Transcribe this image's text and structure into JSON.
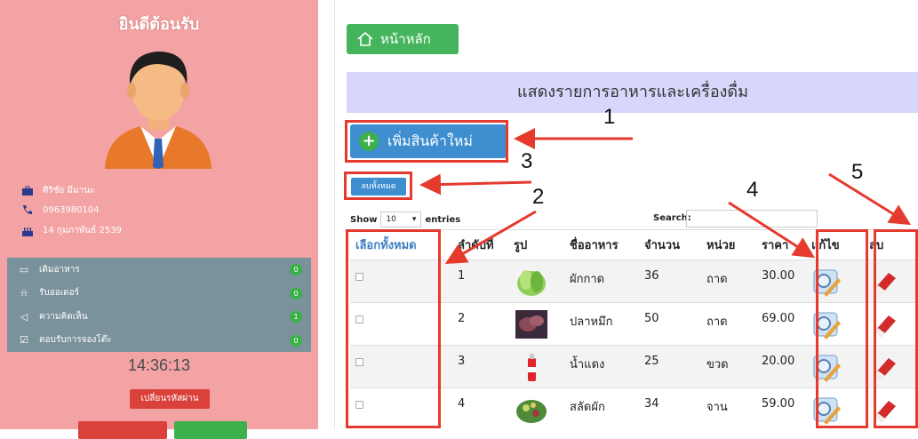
{
  "sidebar": {
    "welcome": "ยินดีต้อนรับ",
    "name": "ศิริชัย มีมานะ",
    "phone": "0963980104",
    "birthday": "14 กุมภาพันธ์ 2539",
    "menu": [
      {
        "label": "เติมอาหาร",
        "icon": "battery-icon",
        "count": "0"
      },
      {
        "label": "รับออเดอร์",
        "icon": "bell-icon",
        "count": "0"
      },
      {
        "label": "ความคิดเห็น",
        "icon": "megaphone-icon",
        "count": "1"
      },
      {
        "label": "ตอบรับการจองโต๊ะ",
        "icon": "check-square-icon",
        "count": "0"
      }
    ],
    "clock": "14:36:13",
    "change_password": "เปลี่ยนรหัสผ่าน"
  },
  "main": {
    "home": "หน้าหลัก",
    "header": "แสดงรายการอาหารและเครื่องดื่ม",
    "add_new": "เพิ่มสินค้าใหม่",
    "delete_all": "ลบทั้งหมด",
    "show": "Show",
    "entries_value": "10",
    "entries": "entries",
    "search": "Search:"
  },
  "table": {
    "headers": [
      "เลือกทั้งหมด",
      "ลำดับที่",
      "รูป",
      "ชื่ออาหาร",
      "จำนวน",
      "หน่วย",
      "ราคา",
      "แก้ไข",
      "ลบ"
    ],
    "rows": [
      {
        "no": "1",
        "name": "ผักกาด",
        "qty": "36",
        "unit": "ถาด",
        "price": "30.00"
      },
      {
        "no": "2",
        "name": "ปลาหมึก",
        "qty": "50",
        "unit": "ถาด",
        "price": "69.00"
      },
      {
        "no": "3",
        "name": "น้ำแดง",
        "qty": "25",
        "unit": "ขวด",
        "price": "20.00"
      },
      {
        "no": "4",
        "name": "สลัดผัก",
        "qty": "34",
        "unit": "จาน",
        "price": "59.00"
      }
    ]
  },
  "annotations": [
    "1",
    "2",
    "3",
    "4",
    "5"
  ],
  "colors": {
    "sidebar": "#f4a3a4",
    "menu": "#7a929c",
    "accent_green": "#44b55c",
    "accent_blue": "#3e8ed0",
    "annotation_red": "#e53a2e"
  }
}
